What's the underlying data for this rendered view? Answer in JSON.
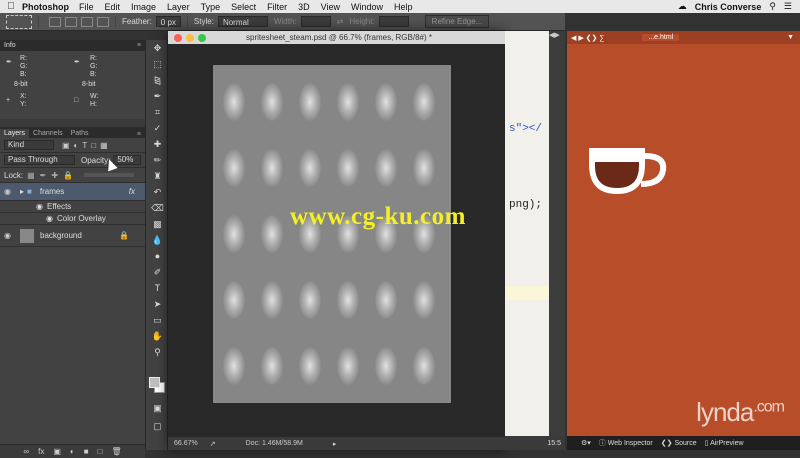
{
  "menubar": {
    "app": "Photoshop",
    "items": [
      "File",
      "Edit",
      "Image",
      "Layer",
      "Type",
      "Select",
      "Filter",
      "3D",
      "View",
      "Window",
      "Help"
    ],
    "user": "Chris Converse"
  },
  "options_bar": {
    "feather_label": "Feather:",
    "feather_value": "0 px",
    "style_label": "Style:",
    "style_value": "Normal",
    "width_label": "Width:",
    "height_label": "Height:",
    "refine_label": "Refine Edge..."
  },
  "info_panel": {
    "title": "Info",
    "rgb1": "R:\nG:\nB:",
    "rgb2": "R:\nG:\nB:",
    "bit1": "8-bit",
    "bit2": "8-bit",
    "xy": "X:\nY:",
    "wh": "W:\nH:"
  },
  "layers_panel": {
    "tabs": [
      "Layers",
      "Channels",
      "Paths"
    ],
    "kind": "Kind",
    "blend": "Pass Through",
    "opacity_label": "Opacity:",
    "opacity_value": "50%",
    "lock_label": "Lock:",
    "layers": [
      {
        "name": "frames",
        "fx": "fx"
      },
      {
        "name": "Effects"
      },
      {
        "name": "Color Overlay"
      },
      {
        "name": "background"
      }
    ]
  },
  "document": {
    "title": "spritesheet_steam.psd @ 66.7% (frames, RGB/8#) *",
    "zoom": "66.67%",
    "doc_size": "Doc: 1.46M/58.9M"
  },
  "code": {
    "line1": "s\"></",
    "line2": "png);",
    "status": "15:5"
  },
  "preview": {
    "tab": "...e.html",
    "footer": {
      "inspector": "Web Inspector",
      "source": "Source",
      "airpreview": "AirPreview"
    },
    "brand": "lynda",
    "brand_suffix": ".com",
    "colors": {
      "background": "#b84d2a",
      "cup": "#ffffff",
      "coffee": "#6b2a18"
    }
  },
  "watermark": "www.cg-ku.com"
}
